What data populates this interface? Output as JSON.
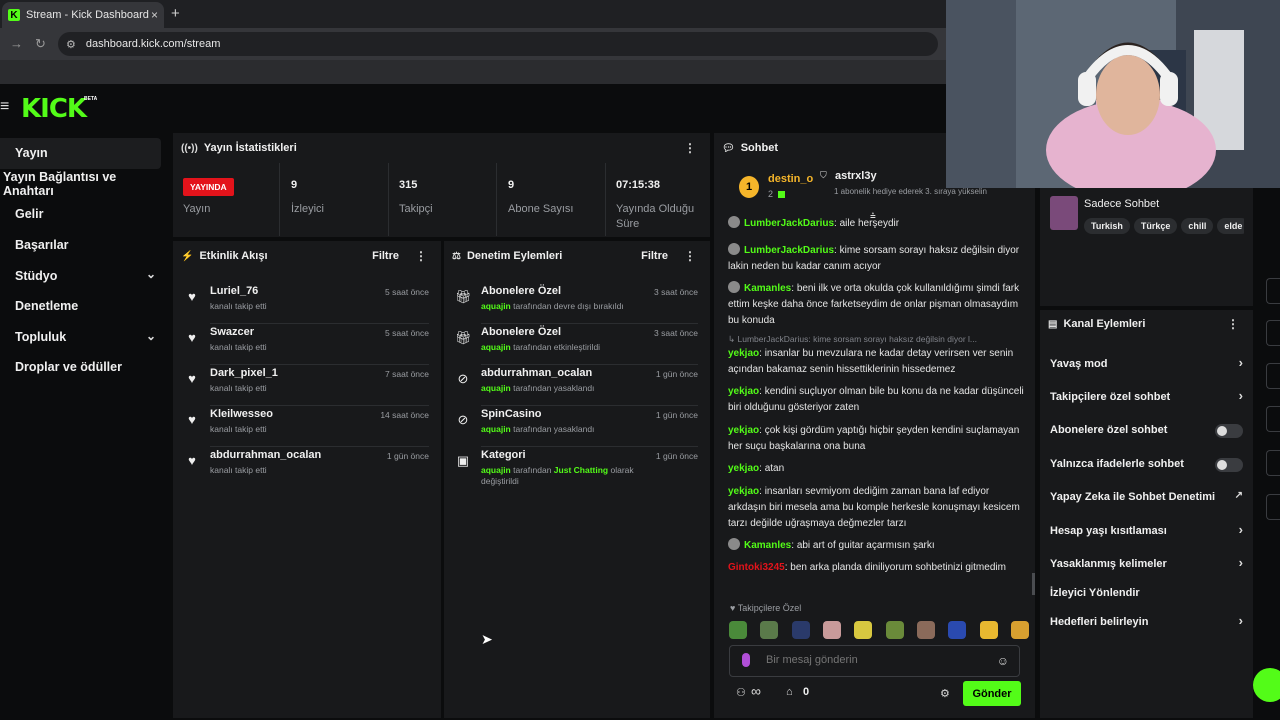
{
  "browser": {
    "tab_title": "Stream - Kick Dashboard",
    "tab_close": "×",
    "new_tab": "+",
    "url": "dashboard.kick.com/stream"
  },
  "brand": {
    "logo": "KICK",
    "beta": "BETA",
    "accent": "#53fc18"
  },
  "sidebar": {
    "items": [
      {
        "label": "Yayın"
      },
      {
        "label": "Yayın Bağlantısı ve Anahtarı"
      },
      {
        "label": "Gelir"
      },
      {
        "label": "Başarılar"
      },
      {
        "label": "Stüdyo"
      },
      {
        "label": "Denetleme"
      },
      {
        "label": "Topluluk"
      },
      {
        "label": "Droplar ve ödüller"
      }
    ]
  },
  "stats": {
    "title": "Yayın İstatistikleri",
    "live_badge": "YAYINDA",
    "items": [
      {
        "value": "",
        "label": "Yayın"
      },
      {
        "value": "9",
        "label": "İzleyici"
      },
      {
        "value": "315",
        "label": "Takipçi"
      },
      {
        "value": "9",
        "label": "Abone Sayısı"
      },
      {
        "value": "07:15:38",
        "label": "Yayında Olduğu Süre"
      }
    ]
  },
  "activity": {
    "title": "Etkinlik Akışı",
    "filter": "Filtre",
    "rows": [
      {
        "name": "Luriel_76",
        "sub": "kanalı takip etti",
        "time": "5 saat önce"
      },
      {
        "name": "Swazcer",
        "sub": "kanalı takip etti",
        "time": "5 saat önce"
      },
      {
        "name": "Dark_pixel_1",
        "sub": "kanalı takip etti",
        "time": "7 saat önce"
      },
      {
        "name": "Kleilwesseo",
        "sub": "kanalı takip etti",
        "time": "14 saat önce"
      },
      {
        "name": "abdurrahman_ocalan",
        "sub": "kanalı takip etti",
        "time": "1 gün önce"
      }
    ]
  },
  "moderation": {
    "title": "Denetim Eylemleri",
    "filter": "Filtre",
    "rows": [
      {
        "name": "Abonelere Özel",
        "actor": "aquajin",
        "sub": "tarafından devre dışı bırakıldı",
        "time": "3 saat önce"
      },
      {
        "name": "Abonelere Özel",
        "actor": "aquajin",
        "sub": "tarafından etkinleştirildi",
        "time": "3 saat önce"
      },
      {
        "name": "abdurrahman_ocalan",
        "actor": "aquajin",
        "sub": "tarafından yasaklandı",
        "time": "1 gün önce"
      },
      {
        "name": "SpinCasino",
        "actor": "aquajin",
        "sub": "tarafından yasaklandı",
        "time": "1 gün önce"
      },
      {
        "name": "Kategori",
        "actor": "aquajin",
        "sub_pre": "tarafından",
        "category": "Just Chatting",
        "sub_post": "olarak",
        "sub2": "değiştirildi",
        "time": "1 gün önce"
      }
    ]
  },
  "chat": {
    "title": "Sohbet",
    "top_user": "destin_o",
    "top_rank": "1",
    "top_count": "2",
    "gifter": "astrxl3y",
    "gifter_note": "1 abonelik hediye ederek 3. sıraya yükselin",
    "messages": [
      {
        "user": "LumberJackDarius",
        "text": "aile herşeydir",
        "color": "#53fc18",
        "avatar": true
      },
      {
        "user": "LumberJackDarius",
        "text": "kime sorsam sorayı haksız değilsin diyor lakin neden bu kadar canım acıyor",
        "color": "#53fc18",
        "avatar": true
      },
      {
        "user": "Kamanles",
        "text": "beni ilk ve orta okulda çok kullanıldığımı şimdi fark ettim keşke daha önce farketseydim de onlar pişman olmasaydım bu konuda",
        "color": "#53fc18",
        "avatar": true
      },
      {
        "reply": "LumberJackDarius: kime sorsam sorayı haksız değilsin diyor l...",
        "user": "yekjao",
        "text": "insanlar bu mevzulara ne kadar detay verirsen ver senin açından bakamaz senin hissettiklerinin hissedemez",
        "color": "#53fc18"
      },
      {
        "user": "yekjao",
        "text": "kendini suçluyor olman bile bu konu da ne kadar düşünceli biri olduğunu gösteriyor zaten",
        "color": "#53fc18"
      },
      {
        "user": "yekjao",
        "text": "çok kişi gördüm yaptığı hiçbir şeyden kendini suçlamayan her suçu başkalarına ona buna",
        "color": "#53fc18"
      },
      {
        "user": "yekjao",
        "text": "atan",
        "color": "#53fc18"
      },
      {
        "user": "yekjao",
        "text": "insanları sevmiyom dediğim zaman bana laf ediyor arkdaşın biri mesela ama bu komple herkesle konuşmayı kesicem tarzı değilde uğraşmaya değmezler tarzı",
        "color": "#53fc18"
      },
      {
        "user": "Kamanles",
        "text": "abi art of guitar açarmısın şarkı",
        "color": "#53fc18",
        "avatar": true
      },
      {
        "user": "Gintoki3245",
        "text": "ben arka planda diniliyorum sohbetinizi gitmedim",
        "color": "#e3131b"
      }
    ],
    "follower_only": "Takipçilere Özel",
    "input_placeholder": "Bir mesaj gönderin",
    "send": "Gönder",
    "counter": "0",
    "infinity": "∞"
  },
  "stream_info": {
    "title": "Sadece Sohbet",
    "tags": [
      "Turkish",
      "Türkçe",
      "chill",
      "elde"
    ]
  },
  "channel_actions": {
    "title": "Kanal Eylemleri",
    "rows": [
      {
        "label": "Yavaş mod",
        "ctrl": "chev"
      },
      {
        "label": "Takipçilere özel sohbet",
        "ctrl": "chev"
      },
      {
        "label": "Abonelere özel sohbet",
        "ctrl": "toggle"
      },
      {
        "label": "Yalnızca ifadelerle sohbet",
        "ctrl": "toggle"
      },
      {
        "label": "Yapay Zeka ile Sohbet Denetimi",
        "ctrl": "ext"
      },
      {
        "label": "Hesap yaşı kısıtlaması",
        "ctrl": "chev"
      },
      {
        "label": "Yasaklanmış kelimeler",
        "ctrl": "chev"
      },
      {
        "label": "İzleyici Yönlendir",
        "ctrl": "none"
      },
      {
        "label": "Hedefleri belirleyin",
        "ctrl": "chev"
      }
    ]
  }
}
